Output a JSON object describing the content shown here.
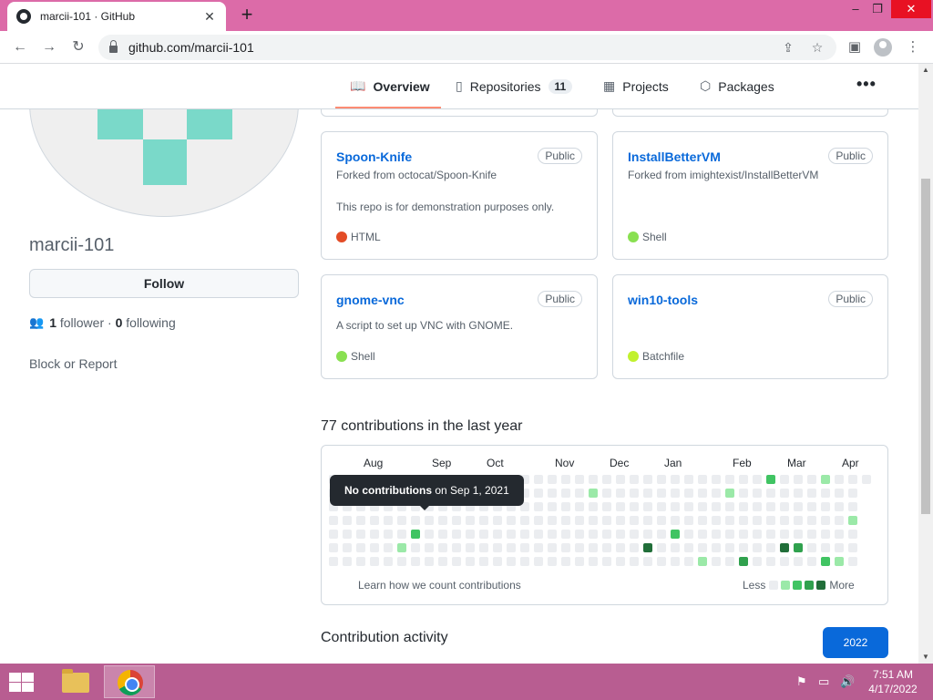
{
  "browser": {
    "tab_title": "marcii-101 · GitHub",
    "tab_close": "✕",
    "new_tab": "+",
    "url": "github.com/marcii-101",
    "window_controls": {
      "minimize": "–",
      "maximize": "❐",
      "close": "✕"
    },
    "icons": [
      "back-icon",
      "forward-icon",
      "reload-icon",
      "lock-icon",
      "share-icon",
      "star-icon",
      "sidepanel-icon",
      "profile-icon",
      "menu-icon"
    ]
  },
  "profile": {
    "username": "marcii-101",
    "follow_label": "Follow",
    "followers_count": "1",
    "followers_label": "follower",
    "separator": "·",
    "following_count": "0",
    "following_label": "following",
    "block_report": "Block or Report"
  },
  "nav": {
    "overview": "Overview",
    "repositories": "Repositories",
    "repositories_count": "11",
    "projects": "Projects",
    "packages": "Packages",
    "more": "•••"
  },
  "repos": [
    {
      "name": "Spoon-Knife",
      "visibility": "Public",
      "fork": "Forked from octocat/Spoon-Knife",
      "description": "This repo is for demonstration purposes only.",
      "language": "HTML",
      "lang_color": "#e34c26"
    },
    {
      "name": "InstallBetterVM",
      "visibility": "Public",
      "fork": "Forked from imightexist/InstallBetterVM",
      "description": "",
      "language": "Shell",
      "lang_color": "#89e051"
    },
    {
      "name": "gnome-vnc",
      "visibility": "Public",
      "fork": "",
      "description": "A script to set up VNC with GNOME.",
      "language": "Shell",
      "lang_color": "#89e051"
    },
    {
      "name": "win10-tools",
      "visibility": "Public",
      "fork": "",
      "description": "",
      "language": "Batchfile",
      "lang_color": "#c1f12e"
    }
  ],
  "contributions": {
    "title": "77 contributions in the last year",
    "months": [
      "Aug",
      "Sep",
      "Oct",
      "Nov",
      "Dec",
      "Jan",
      "Feb",
      "Mar",
      "Apr"
    ],
    "learn_link": "Learn how we count contributions",
    "legend_less": "Less",
    "legend_more": "More",
    "levels": [
      "#ebedf0",
      "#9be9a8",
      "#40c463",
      "#30a14e",
      "#216e39"
    ],
    "tooltip_bold": "No contributions",
    "tooltip_rest": "on Sep 1, 2021"
  },
  "activity": {
    "title": "Contribution activity",
    "year_button": "2022"
  },
  "taskbar": {
    "time": "7:51 AM",
    "date": "4/17/2022",
    "tray_icons": [
      "flag-icon",
      "network-icon",
      "volume-icon"
    ]
  }
}
